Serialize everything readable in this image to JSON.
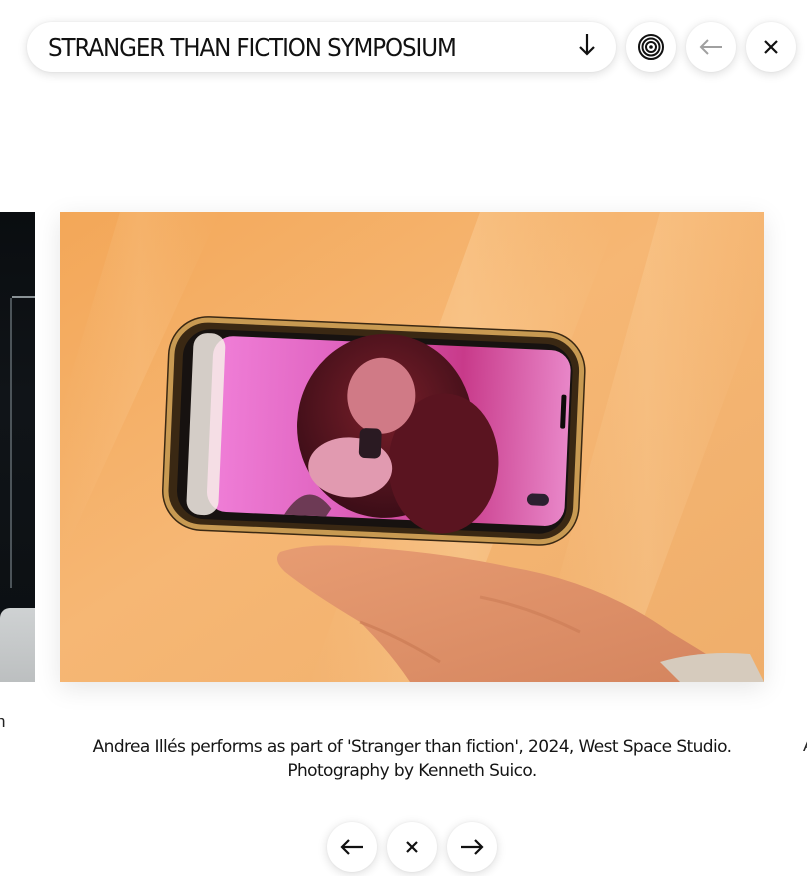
{
  "header": {
    "title": "STRANGER THAN FICTION SYMPOSIUM"
  },
  "icons": {
    "expand": "arrow-down-icon",
    "target": "target-icon",
    "back": "arrow-left-icon",
    "close": "close-icon",
    "prev": "arrow-left-icon",
    "next": "arrow-right-icon"
  },
  "gallery": {
    "prev_caption_fragment": "n",
    "next_caption_fragment": "A",
    "current": {
      "caption_line1": "Andrea Illés performs as part of 'Stranger than fiction', 2024, West Space Studio.",
      "caption_line2": "Photography by Kenneth Suico."
    }
  },
  "colors": {
    "background": "#ffffff",
    "text": "#111111",
    "disabled_icon": "#9a9a9a",
    "photo_background": "#f0a85c"
  }
}
